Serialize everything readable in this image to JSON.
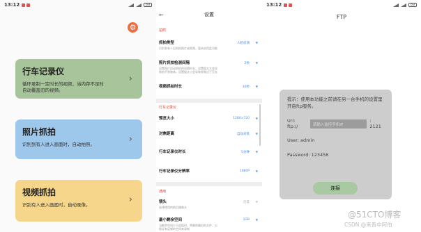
{
  "status": {
    "s1_time": "13:12",
    "s3_time": "13:12",
    "battery": "89"
  },
  "screen1": {
    "cards": [
      {
        "title": "行车记录仪",
        "desc": "循环录制一定时长的视频，当内存不足时自动覆盖旧的视频。"
      },
      {
        "title": "照片抓拍",
        "desc": "识别到有人进入画面时，自动拍照。"
      },
      {
        "title": "视频抓拍",
        "desc": "识别有人进入画面时，自动录像。"
      }
    ]
  },
  "screen2": {
    "title": "设置",
    "section_photo": "拍照",
    "section_dashcam": "行车记录仪",
    "section_general": "通用",
    "rows": [
      {
        "label": "抓拍类型",
        "sub": "识别到有人后抓拍照片或视频，暂未启用此功能",
        "value": "人脸侦测"
      },
      {
        "label": "照片抓拍检测间隔",
        "sub": "设置照片自动抓拍的间隔时长，设置值太大会导致拍不到物体，设置值太小会导致视频过于冗长",
        "value": "2秒"
      },
      {
        "label": "视频抓拍时长",
        "sub": "",
        "value": "30秒"
      },
      {
        "label": "预览大小",
        "sub": "",
        "value": "1280×720"
      },
      {
        "label": "对焦距离",
        "sub": "",
        "value": "自动对焦"
      },
      {
        "label": "行车记录仪时长",
        "sub": "",
        "value": "5分钟"
      },
      {
        "label": "行车记录仪分辨率",
        "sub": "",
        "value": "1080P"
      },
      {
        "label": "镜头",
        "sub": "选择使用的前后摄像头",
        "value": "后置"
      },
      {
        "label": "最小剩余空间",
        "sub": "当剩余空间少于此值时，将删除最旧的文件，以保证有足够的空间来录制",
        "value": "1GB"
      }
    ]
  },
  "screen3": {
    "title": "FTP",
    "hint": "提示：使用本功能之前请在另一台手机的设置里开启ftp服务。",
    "url_label": "Url: ftp://",
    "ip_placeholder": "请输入监控手机IP",
    "port": ": 2121",
    "user": "User: admin",
    "password": "Password: 123456",
    "connect": "连接"
  },
  "watermark": {
    "line1": "@51CTO博客",
    "line2": "CSDN @来吾中阿伯"
  },
  "colors": {
    "card1": "#a8c49a",
    "card2": "#9ec7ec",
    "card3": "#f5d68a",
    "accent": "#f26b3a",
    "section_red": "#e0452e",
    "value_blue": "#4a8be0"
  }
}
